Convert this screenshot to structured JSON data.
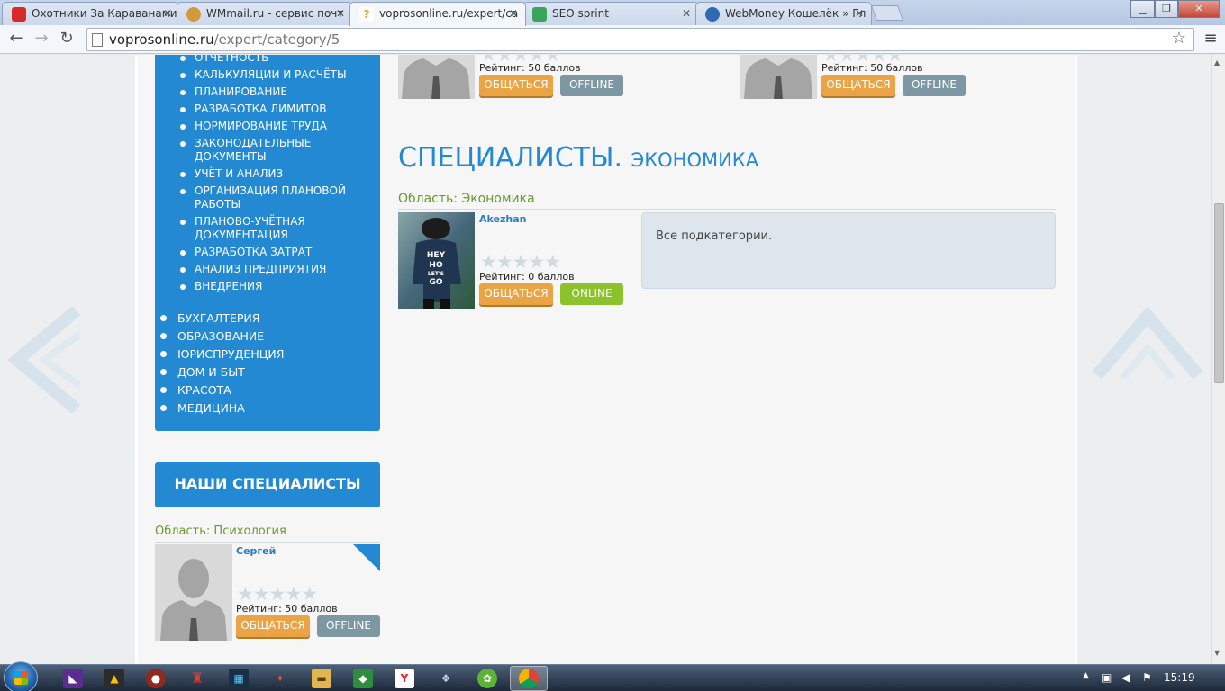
{
  "browser": {
    "tabs": [
      {
        "title": "Охотники За Караванами",
        "icon": "youtube-icon",
        "color": "#d62b2b"
      },
      {
        "title": "WMmail.ru - сервис почт",
        "icon": "wmmail-icon",
        "color": "#d39a3a"
      },
      {
        "title": "voprosonline.ru/expert/ca",
        "icon": "voprosonline-icon",
        "color": "#e8a12d"
      },
      {
        "title": "SEO sprint",
        "icon": "seosprint-icon",
        "color": "#3aa55a"
      },
      {
        "title": "WebMoney Кошелёк » Гл",
        "icon": "webmoney-icon",
        "color": "#2e6ab0"
      }
    ],
    "address_host": "voprosonline.ru",
    "address_path": "/expert/category/5"
  },
  "sidebar": {
    "subcategories": [
      "ОТЧЁТНОСТЬ",
      "КАЛЬКУЛЯЦИИ И РАСЧЁТЫ",
      "ПЛАНИРОВАНИЕ",
      "РАЗРАБОТКА ЛИМИТОВ",
      "НОРМИРОВАНИЕ ТРУДА",
      "ЗАКОНОДАТЕЛЬНЫЕ ДОКУМЕНТЫ",
      "УЧЁТ И АНАЛИЗ",
      "ОРГАНИЗАЦИЯ ПЛАНОВОЙ РАБОТЫ",
      "ПЛАНОВО-УЧЁТНАЯ ДОКУМЕНТАЦИЯ",
      "РАЗРАБОТКА ЗАТРАТ",
      "АНАЛИЗ ПРЕДПРИЯТИЯ",
      "ВНЕДРЕНИЯ"
    ],
    "categories": [
      "БУХГАЛТЕРИЯ",
      "ОБРАЗОВАНИЕ",
      "ЮРИСПРУДЕНЦИЯ",
      "ДОМ И БЫТ",
      "КРАСОТА",
      "МЕДИЦИНА"
    ],
    "our_specialists_title": "НАШИ СПЕЦИАЛИСТЫ",
    "specialist": {
      "area": "Область: Психология",
      "name": "Сергей",
      "stars": "★★★★★",
      "rating": "Рейтинг: 50 баллов",
      "chat": "ОБЩАТЬСЯ",
      "status": "OFFLINE"
    }
  },
  "main": {
    "top_cards": [
      {
        "stars": "★★★★★",
        "rating": "Рейтинг: 50 баллов",
        "chat": "ОБЩАТЬСЯ",
        "status": "OFFLINE"
      },
      {
        "stars": "★★★★★",
        "rating": "Рейтинг: 50 баллов",
        "chat": "ОБЩАТЬСЯ",
        "status": "OFFLINE"
      }
    ],
    "title_big": "СПЕЦИАЛИСТЫ.",
    "title_small": "ЭКОНОМИКА",
    "area": "Область: Экономика",
    "expert": {
      "name": "Akezhan",
      "avatar_text": "HEY HO LET'S GO",
      "stars": "★★★★★",
      "rating": "Рейтинг: 0 баллов",
      "chat": "ОБЩАТЬСЯ",
      "status": "ONLINE"
    },
    "subcategories_box": "Все подкатегории."
  },
  "taskbar": {
    "clock": "15:19"
  }
}
